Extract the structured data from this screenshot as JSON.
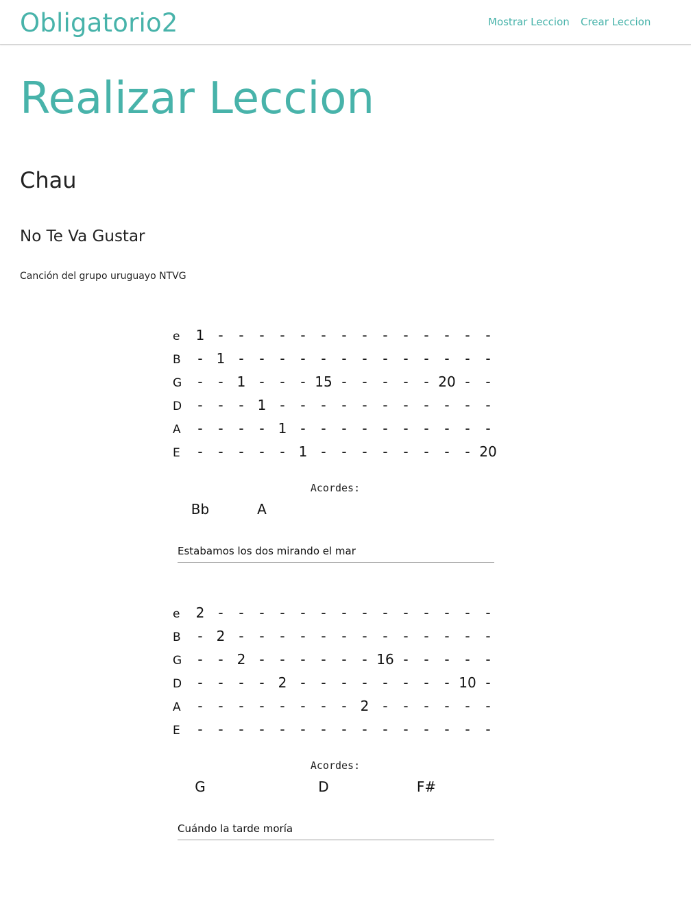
{
  "navbar": {
    "brand": "Obligatorio2",
    "links": [
      "Mostrar Leccion",
      "Crear Leccion"
    ]
  },
  "page": {
    "title": "Realizar Leccion",
    "lesson_name": "Chau",
    "song_title": "No Te Va Gustar",
    "song_description": "Canción del grupo uruguayo NTVG"
  },
  "tabs": [
    {
      "strings": [
        {
          "name": "e",
          "cells": [
            "1",
            "-",
            "-",
            "-",
            "-",
            "-",
            "-",
            "-",
            "-",
            "-",
            "-",
            "-",
            "-",
            "-",
            "-"
          ]
        },
        {
          "name": "B",
          "cells": [
            "-",
            "1",
            "-",
            "-",
            "-",
            "-",
            "-",
            "-",
            "-",
            "-",
            "-",
            "-",
            "-",
            "-",
            "-"
          ]
        },
        {
          "name": "G",
          "cells": [
            "-",
            "-",
            "1",
            "-",
            "-",
            "-",
            "15",
            "-",
            "-",
            "-",
            "-",
            "-",
            "20",
            "-",
            "-"
          ]
        },
        {
          "name": "D",
          "cells": [
            "-",
            "-",
            "-",
            "1",
            "-",
            "-",
            "-",
            "-",
            "-",
            "-",
            "-",
            "-",
            "-",
            "-",
            "-"
          ]
        },
        {
          "name": "A",
          "cells": [
            "-",
            "-",
            "-",
            "-",
            "1",
            "-",
            "-",
            "-",
            "-",
            "-",
            "-",
            "-",
            "-",
            "-",
            "-"
          ]
        },
        {
          "name": "E",
          "cells": [
            "-",
            "-",
            "-",
            "-",
            "-",
            "1",
            "-",
            "-",
            "-",
            "-",
            "-",
            "-",
            "-",
            "-",
            "20"
          ]
        }
      ],
      "acordes_label": "Acordes:",
      "chords": [
        {
          "name": "Bb",
          "column": 0
        },
        {
          "name": "A",
          "column": 3
        }
      ],
      "lyric": "Estabamos los dos mirando el mar"
    },
    {
      "strings": [
        {
          "name": "e",
          "cells": [
            "2",
            "-",
            "-",
            "-",
            "-",
            "-",
            "-",
            "-",
            "-",
            "-",
            "-",
            "-",
            "-",
            "-",
            "-"
          ]
        },
        {
          "name": "B",
          "cells": [
            "-",
            "2",
            "-",
            "-",
            "-",
            "-",
            "-",
            "-",
            "-",
            "-",
            "-",
            "-",
            "-",
            "-",
            "-"
          ]
        },
        {
          "name": "G",
          "cells": [
            "-",
            "-",
            "2",
            "-",
            "-",
            "-",
            "-",
            "-",
            "-",
            "16",
            "-",
            "-",
            "-",
            "-",
            "-"
          ]
        },
        {
          "name": "D",
          "cells": [
            "-",
            "-",
            "-",
            "-",
            "2",
            "-",
            "-",
            "-",
            "-",
            "-",
            "-",
            "-",
            "-",
            "10",
            "-"
          ]
        },
        {
          "name": "A",
          "cells": [
            "-",
            "-",
            "-",
            "-",
            "-",
            "-",
            "-",
            "-",
            "2",
            "-",
            "-",
            "-",
            "-",
            "-",
            "-"
          ]
        },
        {
          "name": "E",
          "cells": [
            "-",
            "-",
            "-",
            "-",
            "-",
            "-",
            "-",
            "-",
            "-",
            "-",
            "-",
            "-",
            "-",
            "-",
            "-"
          ]
        }
      ],
      "acordes_label": "Acordes:",
      "chords": [
        {
          "name": "G",
          "column": 0
        },
        {
          "name": "D",
          "column": 6
        },
        {
          "name": "F#",
          "column": 11
        }
      ],
      "lyric": "Cuándo la tarde moría"
    }
  ]
}
